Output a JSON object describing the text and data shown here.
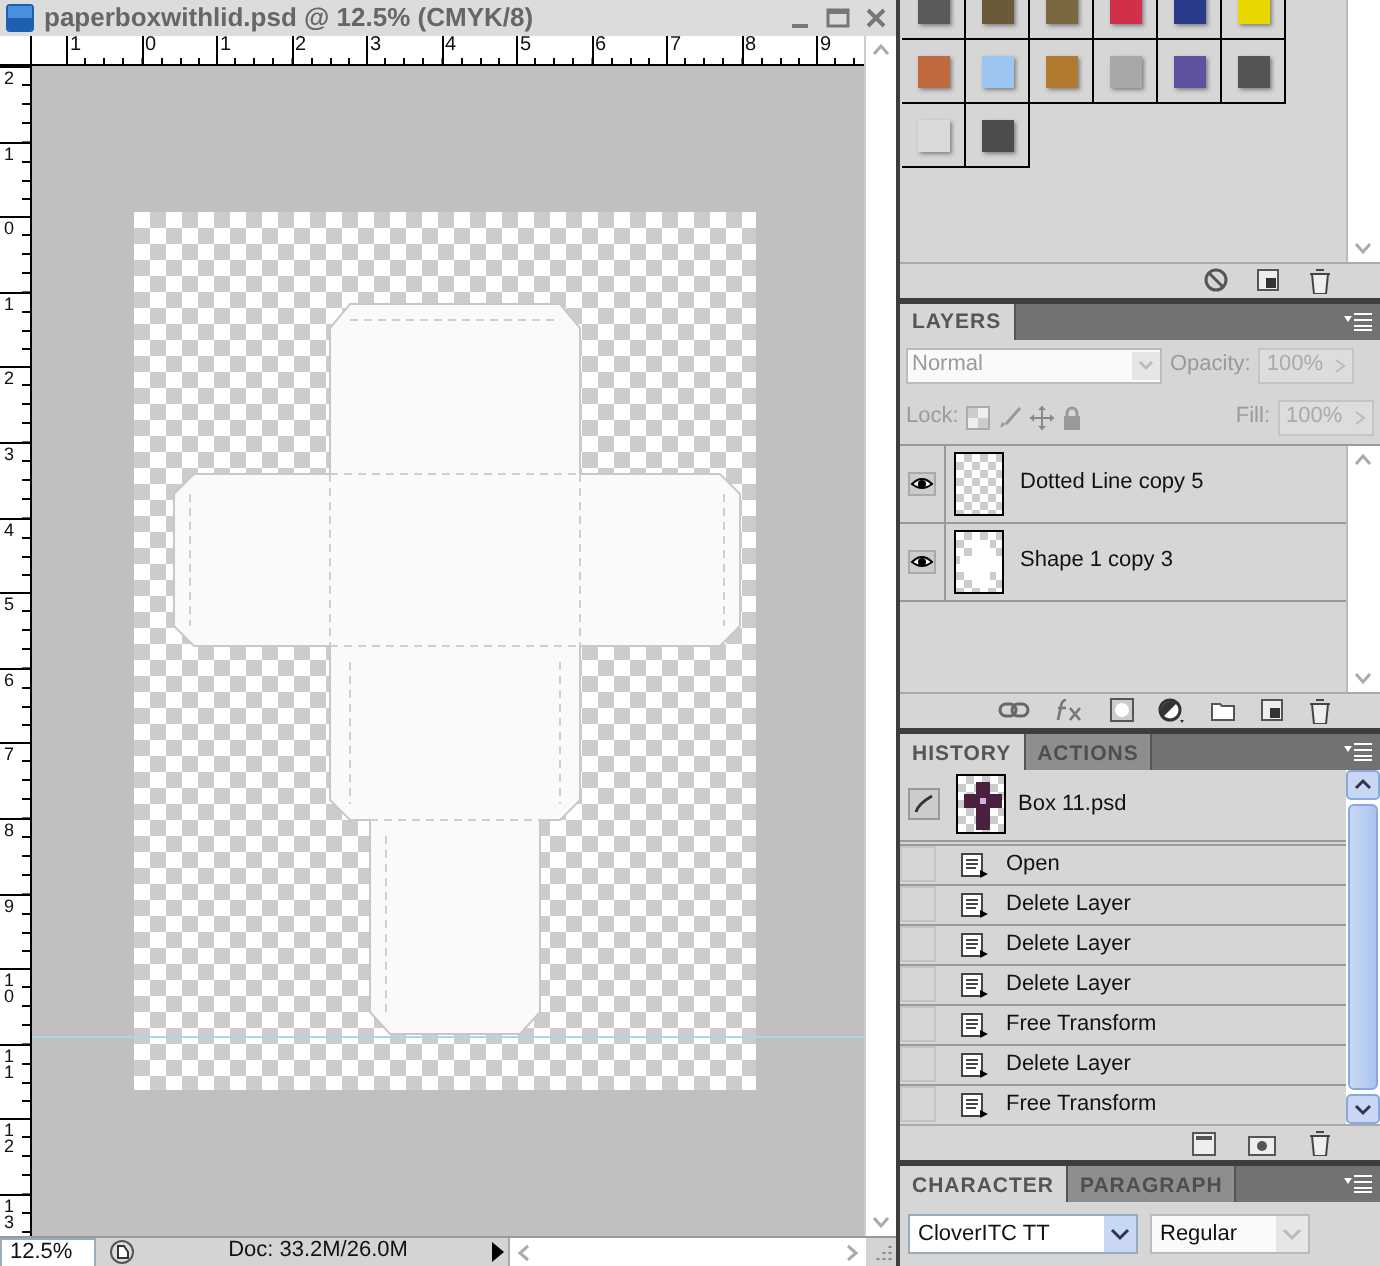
{
  "document_window": {
    "title": "paperboxwithlid.psd @ 12.5% (CMYK/8)",
    "rulers": {
      "horizontal": [
        "1",
        "0",
        "1",
        "2",
        "3",
        "4",
        "5",
        "6",
        "7",
        "8",
        "9"
      ],
      "vertical": [
        "2",
        "1",
        "0",
        "1",
        "2",
        "3",
        "4",
        "5",
        "6",
        "7",
        "8",
        "9",
        "10",
        "11",
        "12",
        "13"
      ]
    },
    "status_bar": {
      "zoom": "12.5%",
      "doc_info": "Doc: 33.2M/26.0M"
    }
  },
  "styles_panel": {
    "swatches": [
      {
        "color": "#5a5a5a"
      },
      {
        "color": "#6b5a3a"
      },
      {
        "color": "#7a6840"
      },
      {
        "color": "#d0304a"
      },
      {
        "color": "#2a3a8a"
      },
      {
        "color": "#e8d800"
      },
      {
        "color": "#c06a40"
      },
      {
        "color": "#9cc6f0"
      },
      {
        "color": "#b07a30"
      },
      {
        "color": "#a8a8a8"
      },
      {
        "color": "#6050a0"
      },
      {
        "color": "#555555"
      },
      {
        "color": "#dadada"
      },
      {
        "color": "#4d4d4d"
      }
    ]
  },
  "layers_panel": {
    "tabs": [
      {
        "label": "LAYERS",
        "selected": true
      }
    ],
    "controls_disabled": true,
    "blend_mode": "Normal",
    "opacity_label": "Opacity:",
    "opacity": "100%",
    "lock_label": "Lock:",
    "fill_label": "Fill:",
    "fill": "100%",
    "layers": [
      {
        "name": "Dotted Line copy 5",
        "visible": true,
        "kind": "empty"
      },
      {
        "name": "Shape 1 copy 3",
        "visible": true,
        "kind": "shape"
      }
    ]
  },
  "history_panel": {
    "tabs": [
      {
        "label": "HISTORY",
        "selected": true
      },
      {
        "label": "ACTIONS",
        "selected": false
      }
    ],
    "snapshot": "Box 11.psd",
    "states": [
      {
        "label": "Open"
      },
      {
        "label": "Delete Layer"
      },
      {
        "label": "Delete Layer"
      },
      {
        "label": "Delete Layer"
      },
      {
        "label": "Free Transform"
      },
      {
        "label": "Delete Layer"
      },
      {
        "label": "Free Transform"
      }
    ]
  },
  "character_panel": {
    "tabs": [
      {
        "label": "CHARACTER",
        "selected": true
      },
      {
        "label": "PARAGRAPH",
        "selected": false
      }
    ],
    "font_family": "CloverITC TT",
    "font_style": "Regular"
  }
}
